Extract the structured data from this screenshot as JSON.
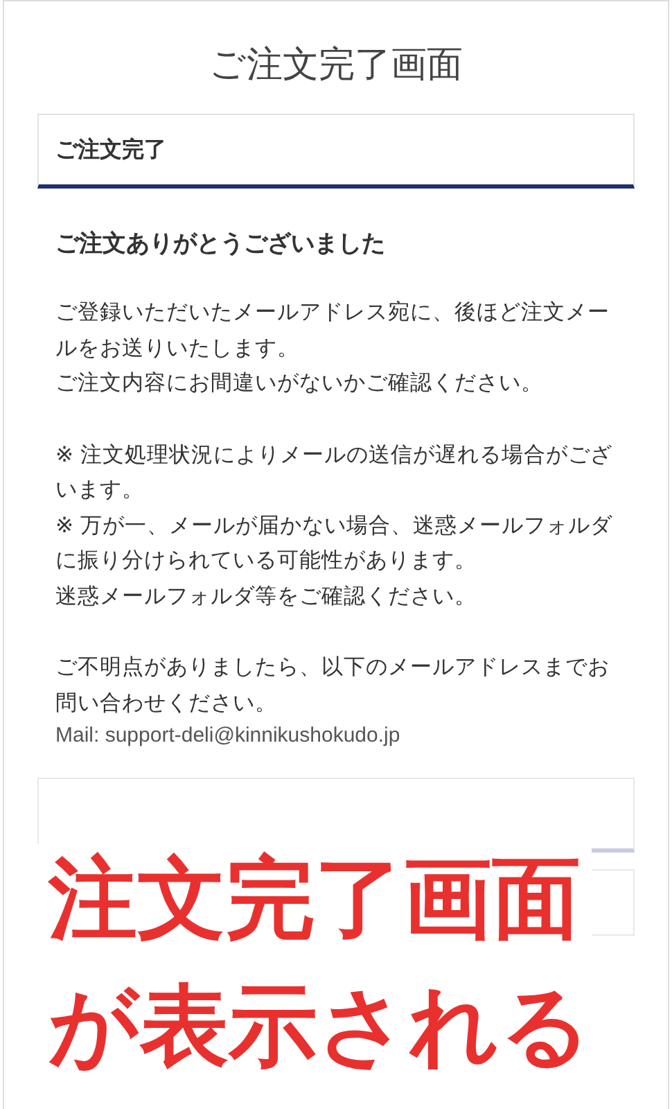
{
  "page": {
    "title": "ご注文完了画面"
  },
  "section": {
    "heading": "ご注文完了"
  },
  "thanks": "ご注文ありがとうございました",
  "paragraphs": [
    [
      "ご登録いただいたメールアドレス宛に、後ほど注文メールをお送りいたします。",
      "ご注文内容にお間違いがないかご確認ください。"
    ],
    [
      "※ 注文処理状況によりメールの送信が遅れる場合がございます。",
      "※ 万が一、メールが届かない場合、迷惑メールフォルダに振り分けられている可能性があります。",
      "迷惑メールフォルダ等をご確認ください。"
    ],
    [
      "ご不明点がありましたら、以下のメールアドレスまでお問い合わせください。"
    ]
  ],
  "mail": "Mail: support-deli@kinnikushokudo.jp",
  "annotation": {
    "lines": [
      "注文完了画面",
      "が表示される"
    ]
  }
}
